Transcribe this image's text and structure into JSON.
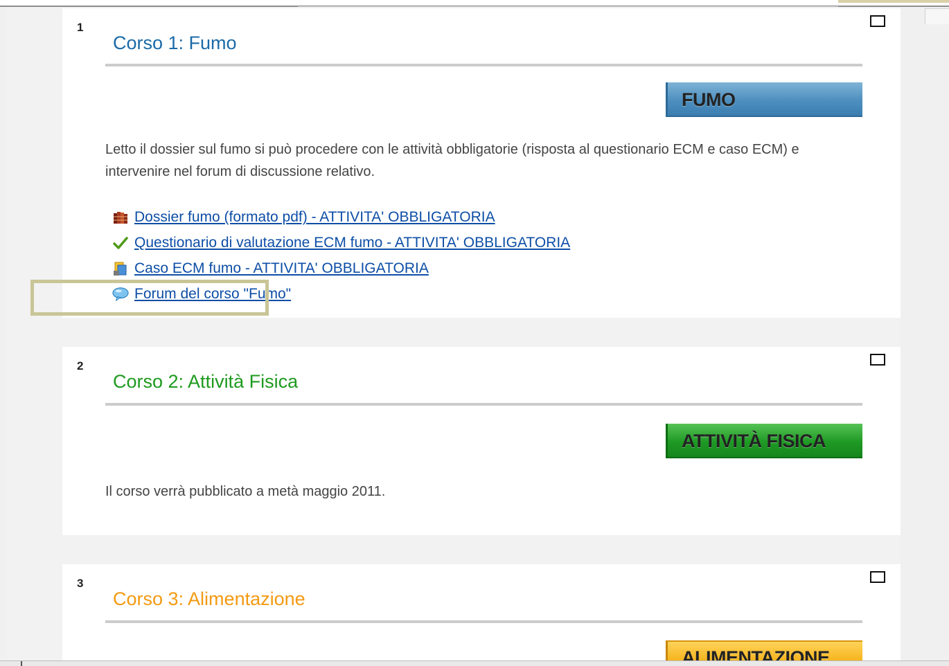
{
  "sections": [
    {
      "number": "1",
      "title": "Corso 1: Fumo",
      "title_color": "#1a6aa8",
      "banner_label": "FUMO",
      "description": "Letto il dossier sul fumo si può procedere con le attività obbligatorie (risposta al questionario ECM e caso ECM) e intervenire nel forum di discussione relativo.",
      "links": [
        {
          "label": "Dossier fumo (formato pdf) - ATTIVITA' OBBLIGATORIA",
          "icon": "book-icon"
        },
        {
          "label": "Questionario di valutazione ECM fumo - ATTIVITA' OBBLIGATORIA",
          "icon": "checkmark-icon"
        },
        {
          "label": "Caso ECM fumo - ATTIVITA' OBBLIGATORIA",
          "icon": "lesson-icon"
        },
        {
          "label": "Forum del corso \"Fumo\"",
          "icon": "speech-bubble-icon"
        }
      ]
    },
    {
      "number": "2",
      "title": "Corso 2: Attività Fisica",
      "title_color": "#1e9a1e",
      "banner_label": "ATTIVITÀ FISICA",
      "description": "Il corso verrà pubblicato a metà maggio 2011."
    },
    {
      "number": "3",
      "title": "Corso 3: Alimentazione",
      "title_color": "#f39a12",
      "banner_label": "ALIMENTAZIONE"
    }
  ],
  "colors": {
    "link": "#0d4ea6",
    "highlight_border": "#c9c597",
    "banner_blue": "#4d8fbf",
    "banner_green": "#1f9a25",
    "banner_orange": "#f6b21a"
  }
}
